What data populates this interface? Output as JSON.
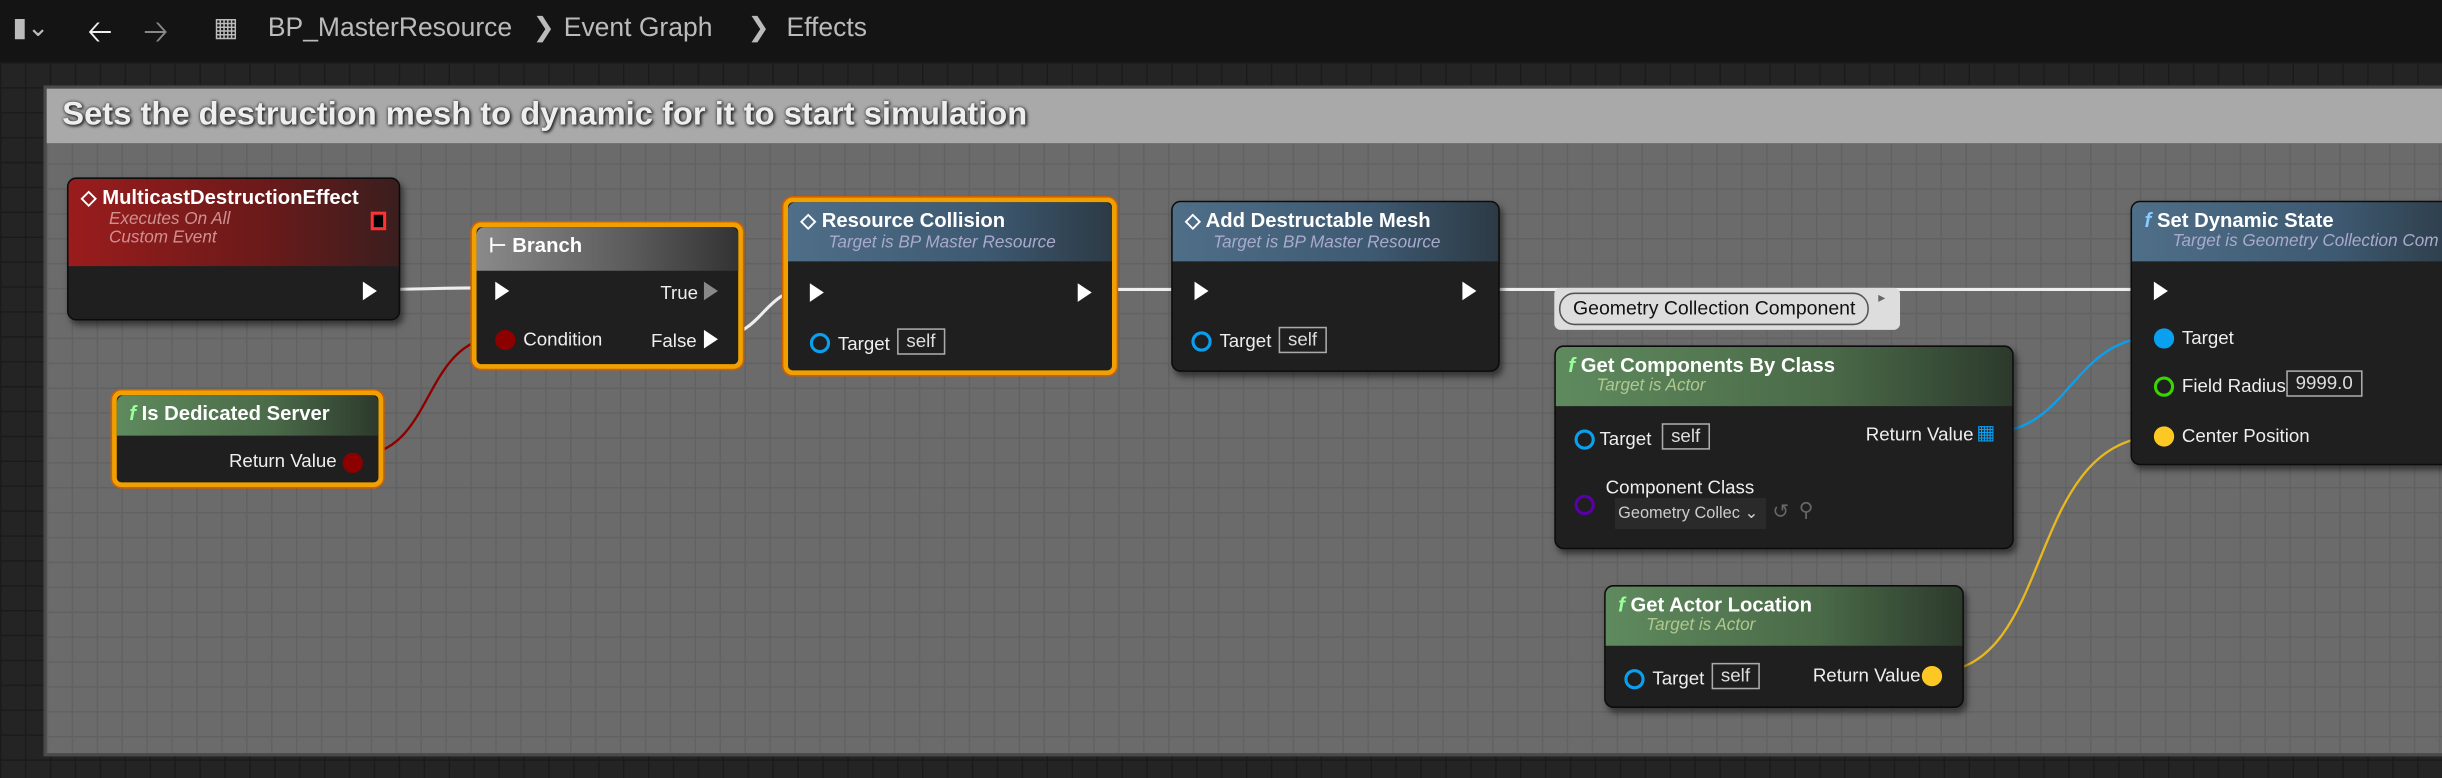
{
  "toolbar": {
    "breadcrumb": [
      "BP_MasterResource",
      "Event Graph",
      "Effects"
    ]
  },
  "comment": {
    "title": "Sets the destruction mesh to dynamic for it to start simulation"
  },
  "nodes": {
    "multicast": {
      "title": "MulticastDestructionEffect",
      "sub1": "Executes On All",
      "sub2": "Custom Event"
    },
    "branch": {
      "title": "Branch",
      "true": "True",
      "false": "False",
      "condition": "Condition"
    },
    "dedicated": {
      "title": "Is Dedicated Server",
      "ret": "Return Value"
    },
    "rescol": {
      "title": "Resource Collision",
      "sub": "Target is BP Master Resource",
      "target": "Target",
      "self": "self"
    },
    "adm": {
      "title": "Add Destructable Mesh",
      "sub": "Target is BP Master Resource",
      "target": "Target",
      "self": "self"
    },
    "bubble": {
      "text": "Geometry Collection Component"
    },
    "gcbc": {
      "title": "Get Components By Class",
      "sub": "Target is Actor",
      "target": "Target",
      "self": "self",
      "ret": "Return Value",
      "cls": "Component Class",
      "cls_value": "Geometry Collec"
    },
    "gal": {
      "title": "Get Actor Location",
      "sub": "Target is Actor",
      "target": "Target",
      "self": "self",
      "ret": "Return Value"
    },
    "sds": {
      "title": "Set Dynamic State",
      "sub": "Target is Geometry Collection Com",
      "target": "Target",
      "radius": "Field Radius",
      "radius_value": "9999.0",
      "center": "Center Position"
    }
  },
  "colors": {
    "exec": "#ffffff",
    "bool": "#8c0000",
    "object": "#0aa0f0",
    "float": "#38d500",
    "vector": "#fdc823",
    "class": "#5a00a8",
    "selected": "#f0a000"
  }
}
